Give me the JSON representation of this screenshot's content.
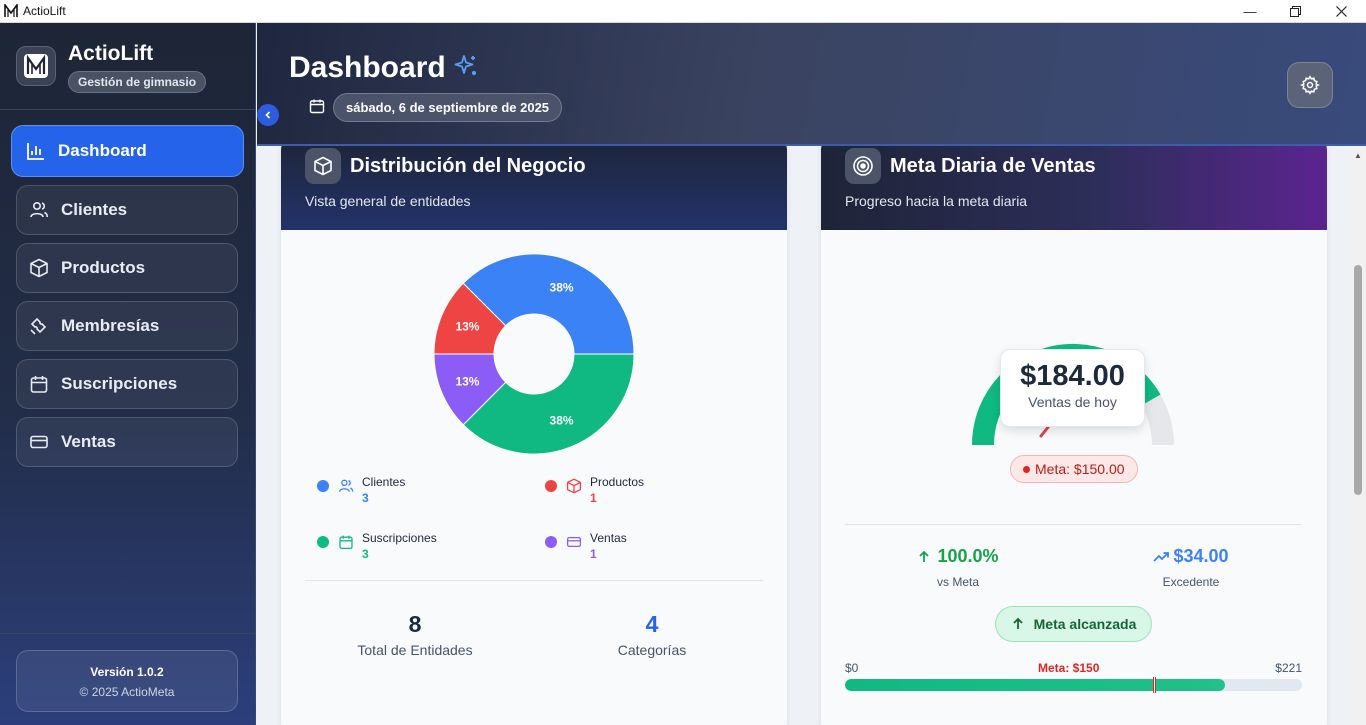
{
  "window": {
    "title": "ActioLift"
  },
  "sidebar": {
    "brand_name": "ActioLift",
    "brand_badge": "Gestión de gimnasio",
    "items": [
      {
        "label": "Dashboard",
        "icon": "bar-chart-icon",
        "active": true
      },
      {
        "label": "Clientes",
        "icon": "users-icon"
      },
      {
        "label": "Productos",
        "icon": "box-icon"
      },
      {
        "label": "Membresías",
        "icon": "tickets-icon"
      },
      {
        "label": "Suscripciones",
        "icon": "calendar-icon"
      },
      {
        "label": "Ventas",
        "icon": "credit-card-icon"
      }
    ],
    "version": "Versión 1.0.2",
    "copyright": "© 2025 ActioMeta"
  },
  "header": {
    "title": "Dashboard",
    "date": "sábado, 6 de septiembre de 2025"
  },
  "distribution_card": {
    "title": "Distribución del Negocio",
    "subtitle": "Vista general de entidades",
    "legend": [
      {
        "name": "Clientes",
        "value": "3",
        "color": "#3b82f6"
      },
      {
        "name": "Productos",
        "value": "1",
        "color": "#ef4444"
      },
      {
        "name": "Suscripciones",
        "value": "3",
        "color": "#10b981"
      },
      {
        "name": "Ventas",
        "value": "1",
        "color": "#8b5cf6"
      }
    ],
    "total_value": "8",
    "total_label": "Total de Entidades",
    "categories_value": "4",
    "categories_label": "Categorías"
  },
  "sales_card": {
    "title": "Meta Diaria de Ventas",
    "subtitle": "Progreso hacia la meta diaria",
    "amount": "$184.00",
    "amount_label": "Ventas de hoy",
    "goal_pill": "Meta: $150.00",
    "pct_value": "100.0%",
    "pct_label": "vs Meta",
    "excess_value": "$34.00",
    "excess_label": "Excedente",
    "status_label": "Meta alcanzada",
    "bar_min": "$0",
    "bar_goal_label": "Meta: $150",
    "bar_max": "$221",
    "progress_fraction": 0.832,
    "goal_fraction": 0.679
  },
  "chart_data": {
    "type": "pie",
    "categories": [
      "Clientes",
      "Productos",
      "Suscripciones",
      "Ventas"
    ],
    "values": [
      3,
      1,
      3,
      1
    ],
    "labels": [
      "38%",
      "13%",
      "38%",
      "13%"
    ],
    "colors": [
      "#3b82f6",
      "#ef4444",
      "#10b981",
      "#8b5cf6"
    ]
  }
}
